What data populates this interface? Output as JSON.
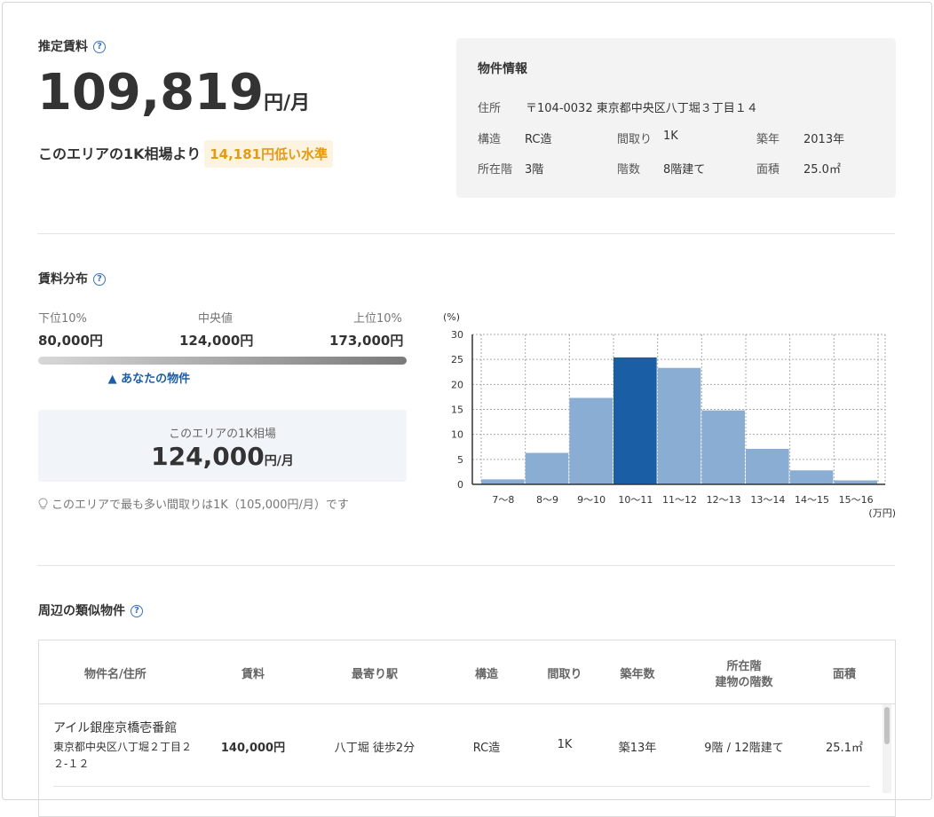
{
  "estimate": {
    "title": "推定賃料",
    "amount": "109,819",
    "unit": "円/月"
  },
  "comparison": {
    "text": "このエリアの1K相場より",
    "badge": "14,181円低い水準"
  },
  "property_info": {
    "title": "物件情報",
    "address_label": "住所",
    "address_value": "〒104-0032 東京都中央区八丁堀３丁目１４",
    "structure_label": "構造",
    "structure_value": "RC造",
    "layout_label": "間取り",
    "layout_value": "1K",
    "built_label": "築年",
    "built_value": "2013年",
    "floor_label": "所在階",
    "floor_value": "3階",
    "floors_label": "階数",
    "floors_value": "8階建て",
    "area_label": "面積",
    "area_value": "25.0㎡"
  },
  "distribution": {
    "title": "賃料分布",
    "low_label": "下位10%",
    "low_value": "80,000円",
    "median_label": "中央値",
    "median_value": "124,000円",
    "high_label": "上位10%",
    "high_value": "173,000円",
    "marker_text": "▲ あなたの物件",
    "marker_fraction": 0.31,
    "area_title": "このエリアの1K相場",
    "area_amount": "124,000",
    "area_unit": "円/月",
    "tip": "このエリアで最も多い間取りは1K（105,000円/月）です",
    "colors": {
      "bar": "#8aaed3",
      "highlight": "#1a5fa6"
    }
  },
  "chart_data": {
    "type": "bar",
    "categories": [
      "7〜8",
      "8〜9",
      "9〜10",
      "10〜11",
      "11〜12",
      "12〜13",
      "13〜14",
      "14〜15",
      "15〜16"
    ],
    "values": [
      1,
      6.3,
      17.3,
      25.4,
      23.3,
      14.8,
      7.1,
      2.8,
      0.8
    ],
    "highlight_index": 3,
    "ylabel": "(%)",
    "xlabel": "(万円)",
    "ylim": [
      0,
      30
    ],
    "yticks": [
      0,
      5,
      10,
      15,
      20,
      25,
      30
    ],
    "grid": true
  },
  "similar": {
    "title": "周辺の類似物件",
    "headers": {
      "name": "物件名/住所",
      "rent": "賃料",
      "station": "最寄り駅",
      "structure": "構造",
      "layout": "間取り",
      "age": "築年数",
      "floor_line1": "所在階",
      "floor_line2": "建物の階数",
      "area": "面積"
    },
    "rows": [
      {
        "name": "アイル銀座京橋壱番館",
        "address_line1": "東京都中央区八丁堀２丁目２",
        "address_line2": "２-１２",
        "rent": "140,000円",
        "station": "八丁堀 徒歩2分",
        "structure": "RC造",
        "layout": "1K",
        "age": "築13年",
        "floor": "9階 / 12階建て",
        "area": "25.1㎡"
      }
    ]
  }
}
